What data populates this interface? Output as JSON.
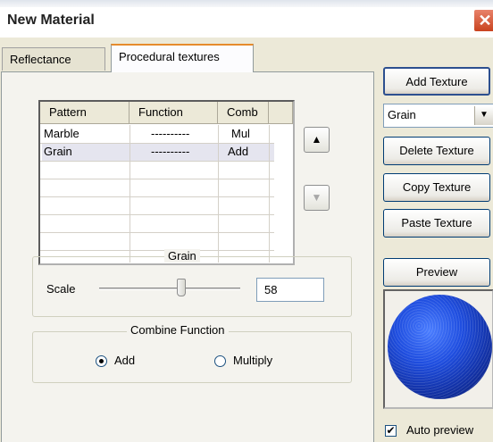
{
  "window": {
    "title": "New Material",
    "close_glyph": "✕"
  },
  "tabs": [
    {
      "label": "Reflectance",
      "active": false
    },
    {
      "label": "Procedural textures",
      "active": true
    }
  ],
  "textures_table": {
    "columns": [
      "Pattern",
      "Function",
      "Comb"
    ],
    "rows": [
      {
        "pattern": "Marble",
        "function": "----------",
        "comb": "Mul"
      },
      {
        "pattern": "Grain",
        "function": "----------",
        "comb": "Add"
      }
    ],
    "selected_row": 1
  },
  "move_buttons": {
    "up": "▲",
    "down": "▼"
  },
  "grain_group": {
    "title": "Grain",
    "scale_label": "Scale",
    "scale_value": "58",
    "scale_fraction": 0.58
  },
  "combine_group": {
    "title": "Combine Function",
    "options": [
      {
        "label": "Add",
        "selected": true
      },
      {
        "label": "Multiply",
        "selected": false
      }
    ]
  },
  "right_panel": {
    "add_texture": "Add Texture",
    "texture_type": "Grain",
    "delete_texture": "Delete Texture",
    "copy_texture": "Copy Texture",
    "paste_texture": "Paste Texture",
    "preview": "Preview",
    "auto_preview_label": "Auto preview",
    "auto_preview_checked": true
  },
  "colors": {
    "accent_tab": "#e68b2c",
    "sphere": "#1f4ee0",
    "close": "#c9431f"
  }
}
